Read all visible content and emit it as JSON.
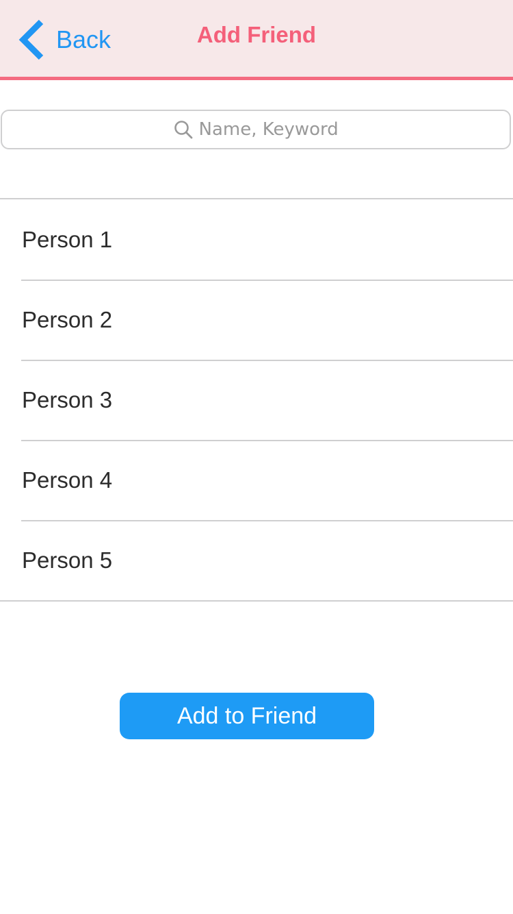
{
  "header": {
    "back_label": "Back",
    "title": "Add Friend"
  },
  "search": {
    "placeholder": "Name, Keyword",
    "value": "",
    "icon": "search-icon"
  },
  "list": {
    "items": [
      {
        "label": "Person 1"
      },
      {
        "label": "Person 2"
      },
      {
        "label": "Person 3"
      },
      {
        "label": "Person 4"
      },
      {
        "label": "Person 5"
      }
    ]
  },
  "actions": {
    "add_label": "Add to Friend"
  },
  "colors": {
    "header_bg": "#f7e8e9",
    "accent_pink": "#f4607a",
    "accent_blue": "#1e9bf5",
    "divider": "#cfcfd0"
  }
}
